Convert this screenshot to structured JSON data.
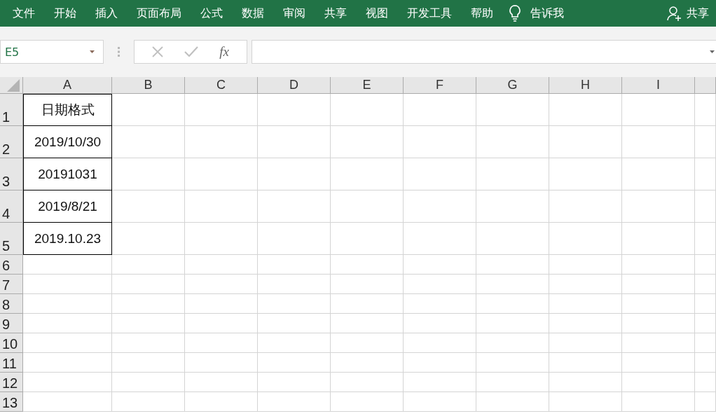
{
  "ribbon_tabs": [
    {
      "label": "文件"
    },
    {
      "label": "开始"
    },
    {
      "label": "插入"
    },
    {
      "label": "页面布局"
    },
    {
      "label": "公式"
    },
    {
      "label": "数据"
    },
    {
      "label": "审阅"
    },
    {
      "label": "共享"
    },
    {
      "label": "视图"
    },
    {
      "label": "开发工具"
    },
    {
      "label": "帮助"
    }
  ],
  "tell_me": "告诉我",
  "share": "共享",
  "formula_bar": {
    "name_box": "E5",
    "function_label": "fx"
  },
  "columns": [
    "A",
    "B",
    "C",
    "D",
    "E",
    "F",
    "G",
    "H",
    "I"
  ],
  "rows": [
    {
      "number": "1",
      "cells": [
        {
          "text": "日期格式",
          "bordered": true
        }
      ]
    },
    {
      "number": "2",
      "cells": [
        {
          "text": "2019/10/30",
          "bordered": true
        }
      ]
    },
    {
      "number": "3",
      "cells": [
        {
          "text": "20191031",
          "bordered": true
        }
      ]
    },
    {
      "number": "4",
      "cells": [
        {
          "text": "2019/8/21",
          "bordered": true
        }
      ]
    },
    {
      "number": "5",
      "cells": [
        {
          "text": "2019.10.23",
          "bordered": true
        }
      ]
    },
    {
      "number": "6",
      "cells": []
    },
    {
      "number": "7",
      "cells": []
    },
    {
      "number": "8",
      "cells": []
    },
    {
      "number": "9",
      "cells": []
    },
    {
      "number": "10",
      "cells": []
    },
    {
      "number": "11",
      "cells": []
    },
    {
      "number": "12",
      "cells": []
    },
    {
      "number": "13",
      "cells": []
    }
  ]
}
